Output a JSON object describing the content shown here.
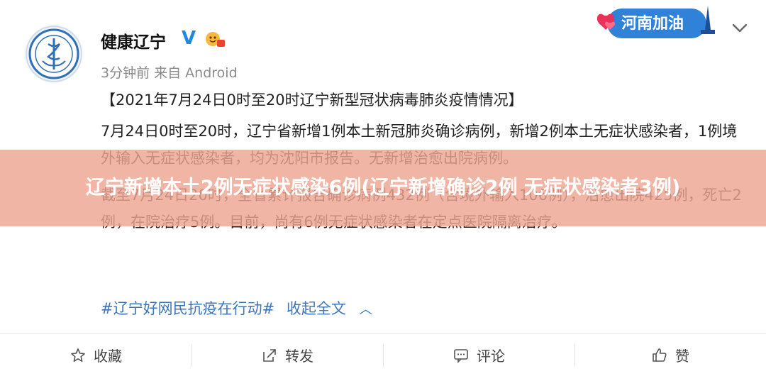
{
  "post": {
    "account_name": "健康辽宁",
    "meta": "3分钟前 来自 Android",
    "headline": "【2021年7月24日0时至20时辽宁新型冠状病毒肺炎疫情情况】",
    "paragraph1": "7月24日0时至20时，辽宁省新增1例本土新冠肺炎确诊病例，新增2例本土无症状感染者，1例境外输入无症状感染者，均为沈阳市报告。无新增治愈出院病例。",
    "paragraph2": "截至7月24日20时，全省累计报告确诊病例432例（含境外输入106例），治愈出院425例，死亡2例，在院治疗5例。目前，尚有6例无症状感染者在定点医院隔离治疗。",
    "hashtag": "#辽宁好网民抗疫在行动#",
    "collapse_label": "收起全文"
  },
  "overlay": {
    "title": "辽宁新增本土2例无症状感染6例(辽宁新增确诊2例 无症状感染者3例)"
  },
  "sticker": {
    "text": "河南加油"
  },
  "actions": {
    "favorite": "收藏",
    "repost": "转发",
    "comment": "评论",
    "like": "赞"
  },
  "icons": {
    "verified": "V",
    "collapse": "^"
  },
  "colors": {
    "link": "#3e76b8",
    "verified": "#1e88e5",
    "overlay": "#eea591"
  }
}
